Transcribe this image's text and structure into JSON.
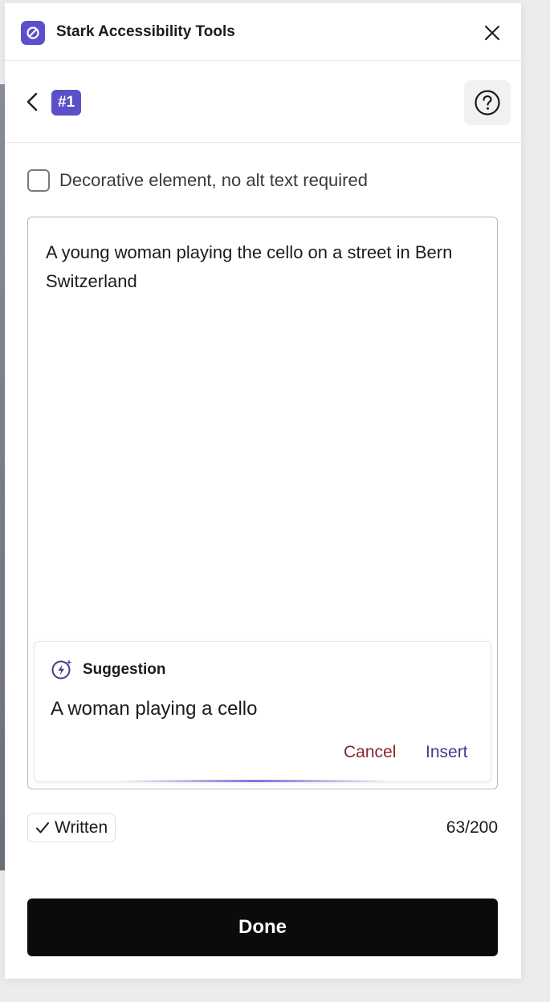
{
  "titlebar": {
    "app_title": "Stark Accessibility Tools",
    "logo_icon": "stark-logo-icon",
    "close_icon": "close-icon",
    "accent_color": "#5b50c9"
  },
  "nav": {
    "back_icon": "chevron-left-icon",
    "item_badge": "#1",
    "help_icon": "question-circle-icon"
  },
  "decorative": {
    "label": "Decorative element, no alt text required",
    "checked": false
  },
  "alt_text": {
    "value": "A young woman playing the cello on a street in Bern Switzerland"
  },
  "suggestion": {
    "icon": "sparkle-bolt-icon",
    "heading": "Suggestion",
    "text": "A woman playing a cello",
    "cancel_label": "Cancel",
    "insert_label": "Insert",
    "cancel_color": "#8b2430",
    "insert_color": "#463b8c"
  },
  "status": {
    "check_icon": "checkmark-icon",
    "written_label": "Written",
    "char_count": "63/200"
  },
  "footer": {
    "done_label": "Done"
  }
}
